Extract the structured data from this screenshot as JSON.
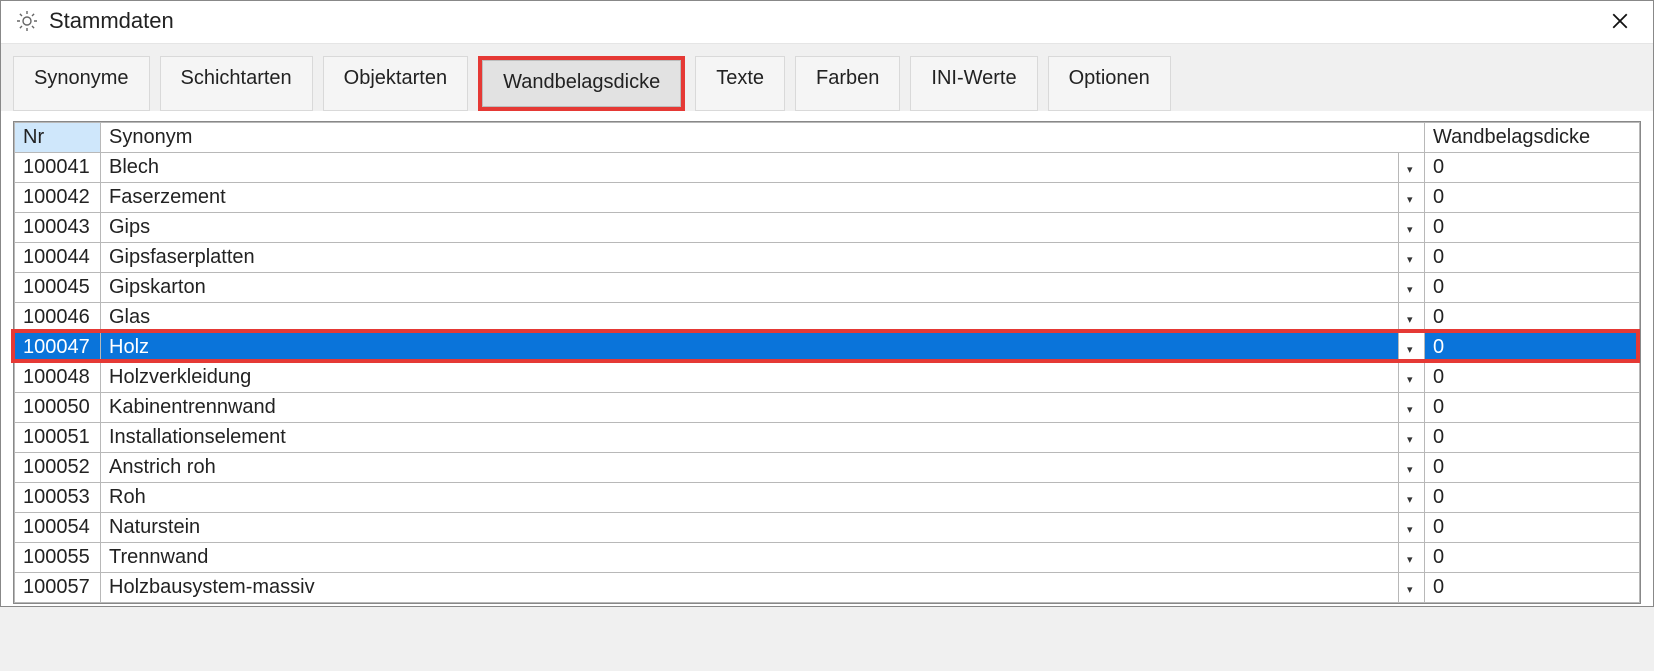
{
  "window": {
    "title": "Stammdaten"
  },
  "tabs": [
    {
      "label": "Synonyme"
    },
    {
      "label": "Schichtarten"
    },
    {
      "label": "Objektarten"
    },
    {
      "label": "Wandbelagsdicke"
    },
    {
      "label": "Texte"
    },
    {
      "label": "Farben"
    },
    {
      "label": "INI-Werte"
    },
    {
      "label": "Optionen"
    }
  ],
  "active_tab_index": 3,
  "columns": {
    "nr": "Nr",
    "synonym": "Synonym",
    "thickness": "Wandbelagsdicke"
  },
  "rows": [
    {
      "nr": "100041",
      "synonym": "Blech",
      "thickness": "0"
    },
    {
      "nr": "100042",
      "synonym": "Faserzement",
      "thickness": "0"
    },
    {
      "nr": "100043",
      "synonym": "Gips",
      "thickness": "0"
    },
    {
      "nr": "100044",
      "synonym": "Gipsfaserplatten",
      "thickness": "0"
    },
    {
      "nr": "100045",
      "synonym": "Gipskarton",
      "thickness": "0"
    },
    {
      "nr": "100046",
      "synonym": "Glas",
      "thickness": "0"
    },
    {
      "nr": "100047",
      "synonym": "Holz",
      "thickness": "0",
      "selected": true
    },
    {
      "nr": "100048",
      "synonym": "Holzverkleidung",
      "thickness": "0"
    },
    {
      "nr": "100050",
      "synonym": "Kabinentrennwand",
      "thickness": "0"
    },
    {
      "nr": "100051",
      "synonym": "Installationselement",
      "thickness": "0"
    },
    {
      "nr": "100052",
      "synonym": "Anstrich roh",
      "thickness": "0"
    },
    {
      "nr": "100053",
      "synonym": "Roh",
      "thickness": "0"
    },
    {
      "nr": "100054",
      "synonym": "Naturstein",
      "thickness": "0"
    },
    {
      "nr": "100055",
      "synonym": "Trennwand",
      "thickness": "0"
    },
    {
      "nr": "100057",
      "synonym": "Holzbausystem-massiv",
      "thickness": "0"
    }
  ]
}
